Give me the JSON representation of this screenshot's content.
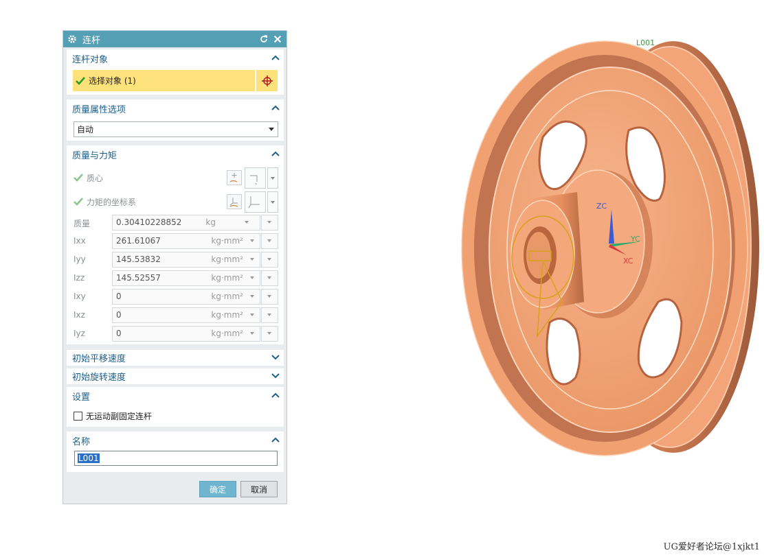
{
  "dialog": {
    "title": "连杆",
    "sections": {
      "link_object": {
        "header": "连杆对象",
        "select_label": "选择对象 (1)"
      },
      "mass_props": {
        "header": "质量属性选项",
        "dropdown_value": "自动"
      },
      "mass_moment": {
        "header": "质量与力矩",
        "center_of_mass": "质心",
        "moment_csys": "力矩的坐标系",
        "rows": [
          {
            "label": "质量",
            "value": "0.30410228852",
            "unit": "kg"
          },
          {
            "label": "Ixx",
            "value": "261.61067",
            "unit": "kg·mm²"
          },
          {
            "label": "Iyy",
            "value": "145.53832",
            "unit": "kg·mm²"
          },
          {
            "label": "Izz",
            "value": "145.52557",
            "unit": "kg·mm²"
          },
          {
            "label": "Ixy",
            "value": "0",
            "unit": "kg·mm²"
          },
          {
            "label": "Ixz",
            "value": "0",
            "unit": "kg·mm²"
          },
          {
            "label": "Iyz",
            "value": "0",
            "unit": "kg·mm²"
          }
        ]
      },
      "init_trans_vel": {
        "header": "初始平移速度"
      },
      "init_rot_vel": {
        "header": "初始旋转速度"
      },
      "settings": {
        "header": "设置",
        "checkbox_label": "无运动副固定连杆"
      },
      "name": {
        "header": "名称",
        "value": "L001"
      }
    },
    "ok_label": "确定",
    "cancel_label": "取消"
  },
  "viewport": {
    "object_label": "L001",
    "axes": {
      "z": "ZC",
      "y": "YC",
      "x": "XC"
    },
    "colors": {
      "part": "#f3a176",
      "axis_z": "#3b5bd6",
      "axis_y": "#2aa86a",
      "axis_x": "#d63b3b",
      "label": "#3a9a3a"
    }
  },
  "watermark": "UG爱好者论坛@1xjkt1"
}
